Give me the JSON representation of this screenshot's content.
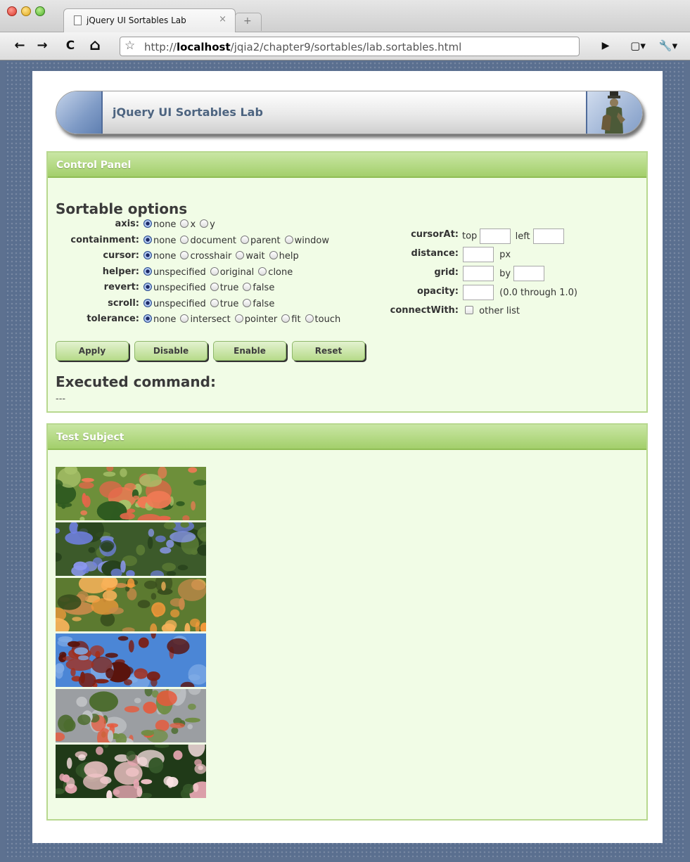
{
  "browser": {
    "tab_title": "jQuery UI Sortables Lab",
    "tab_close": "×",
    "new_tab": "+",
    "url_prefix": "http://",
    "url_host": "localhost",
    "url_path": "/jqia2/chapter9/sortables/lab.sortables.html",
    "nav": {
      "back": "←",
      "forward": "→",
      "reload": "C",
      "home": "⌂",
      "star": "☆",
      "play": "▶",
      "page_menu": "▢▾",
      "tools_menu": "🔧▾"
    }
  },
  "banner": {
    "title": "jQuery UI Sortables Lab"
  },
  "control_panel": {
    "header": "Control Panel",
    "section_title": "Sortable options",
    "options": [
      {
        "label": "axis:",
        "choices": [
          "none",
          "x",
          "y"
        ],
        "selected": 0
      },
      {
        "label": "containment:",
        "choices": [
          "none",
          "document",
          "parent",
          "window"
        ],
        "selected": 0
      },
      {
        "label": "cursor:",
        "choices": [
          "none",
          "crosshair",
          "wait",
          "help"
        ],
        "selected": 0
      },
      {
        "label": "helper:",
        "choices": [
          "unspecified",
          "original",
          "clone"
        ],
        "selected": 0
      },
      {
        "label": "revert:",
        "choices": [
          "unspecified",
          "true",
          "false"
        ],
        "selected": 0
      },
      {
        "label": "scroll:",
        "choices": [
          "unspecified",
          "true",
          "false"
        ],
        "selected": 0
      },
      {
        "label": "tolerance:",
        "choices": [
          "none",
          "intersect",
          "pointer",
          "fit",
          "touch"
        ],
        "selected": 0
      }
    ],
    "cursorAt": {
      "label": "cursorAt:",
      "top_label": "top",
      "left_label": "left",
      "top_value": "",
      "left_value": ""
    },
    "distance": {
      "label": "distance:",
      "value": "",
      "unit": "px"
    },
    "grid": {
      "label": "grid:",
      "by_label": "by",
      "x_value": "",
      "y_value": ""
    },
    "opacity": {
      "label": "opacity:",
      "value": "",
      "hint": "(0.0 through 1.0)"
    },
    "connectWith": {
      "label": "connectWith:",
      "option": "other list",
      "checked": false
    },
    "buttons": {
      "apply": "Apply",
      "disable": "Disable",
      "enable": "Enable",
      "reset": "Reset"
    },
    "executed_title": "Executed command:",
    "executed_value": "---"
  },
  "test_subject": {
    "header": "Test Subject",
    "images": [
      {
        "name": "red-hibiscus-image",
        "palette": [
          "#6d8f3a",
          "#2f5a20",
          "#e4664a",
          "#f07a55",
          "#a8c26a"
        ]
      },
      {
        "name": "blue-flowers-image",
        "palette": [
          "#3c5a2a",
          "#26401b",
          "#6f7fe0",
          "#8b98ee",
          "#5a7a35"
        ]
      },
      {
        "name": "orange-lilies-image",
        "palette": [
          "#5c7a30",
          "#3a4f1e",
          "#f2993a",
          "#f7b25a",
          "#c98a4a"
        ]
      },
      {
        "name": "red-leaves-sky-image",
        "palette": [
          "#4b86d6",
          "#7eaae5",
          "#7a1f14",
          "#a3301e",
          "#5a140d"
        ]
      },
      {
        "name": "red-canna-image",
        "palette": [
          "#9b9ea2",
          "#bfc2c5",
          "#e65a3c",
          "#4b6b2d",
          "#6f8d43"
        ]
      },
      {
        "name": "pink-lilies-image",
        "palette": [
          "#203a18",
          "#36592a",
          "#f1c4c8",
          "#e7a6b2",
          "#fbe2e4"
        ]
      }
    ]
  }
}
